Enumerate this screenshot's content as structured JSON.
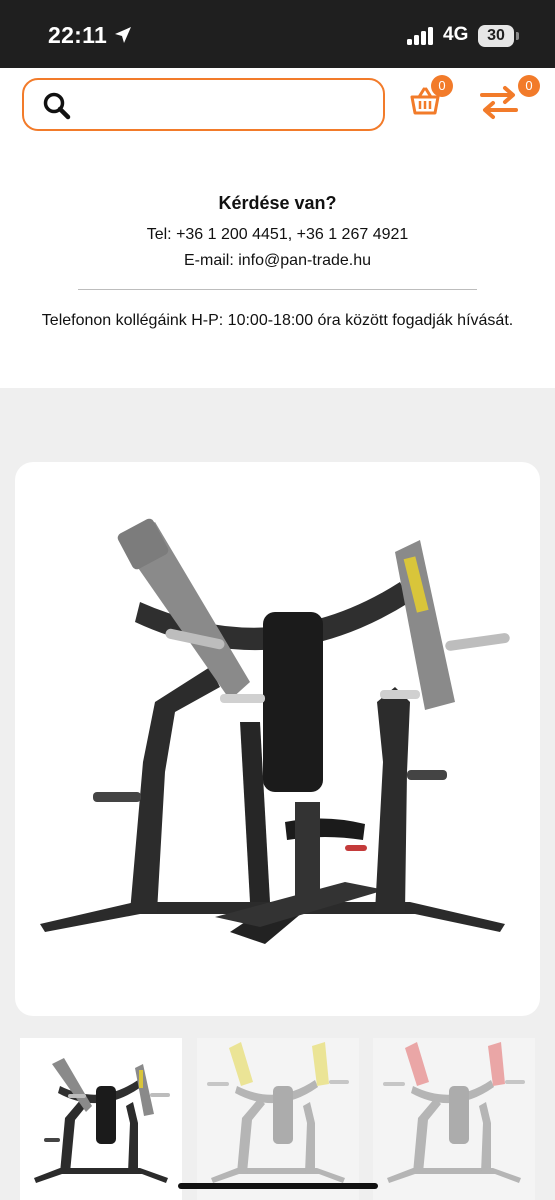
{
  "status_bar": {
    "time": "22:11",
    "network": "4G",
    "battery": "30"
  },
  "header": {
    "search": {
      "placeholder": ""
    },
    "cart": {
      "count": "0",
      "icon": "basket-icon"
    },
    "compare": {
      "count": "0",
      "icon": "swap-arrows-icon"
    },
    "accent_color": "#f27b2a"
  },
  "contact": {
    "title": "Kérdése van?",
    "phone": "Tel: +36 1 200 4451, +36 1 267 4921",
    "email": "E-mail: info@pan-trade.hu",
    "hours": "Telefonon kollégáink H-P: 10:00-18:00 óra között fogadják hívását."
  },
  "gallery": {
    "thumbnail_colors": [
      "#3a3a3a",
      "#e3d53a",
      "#e25a5a"
    ],
    "selected_index": 0
  }
}
